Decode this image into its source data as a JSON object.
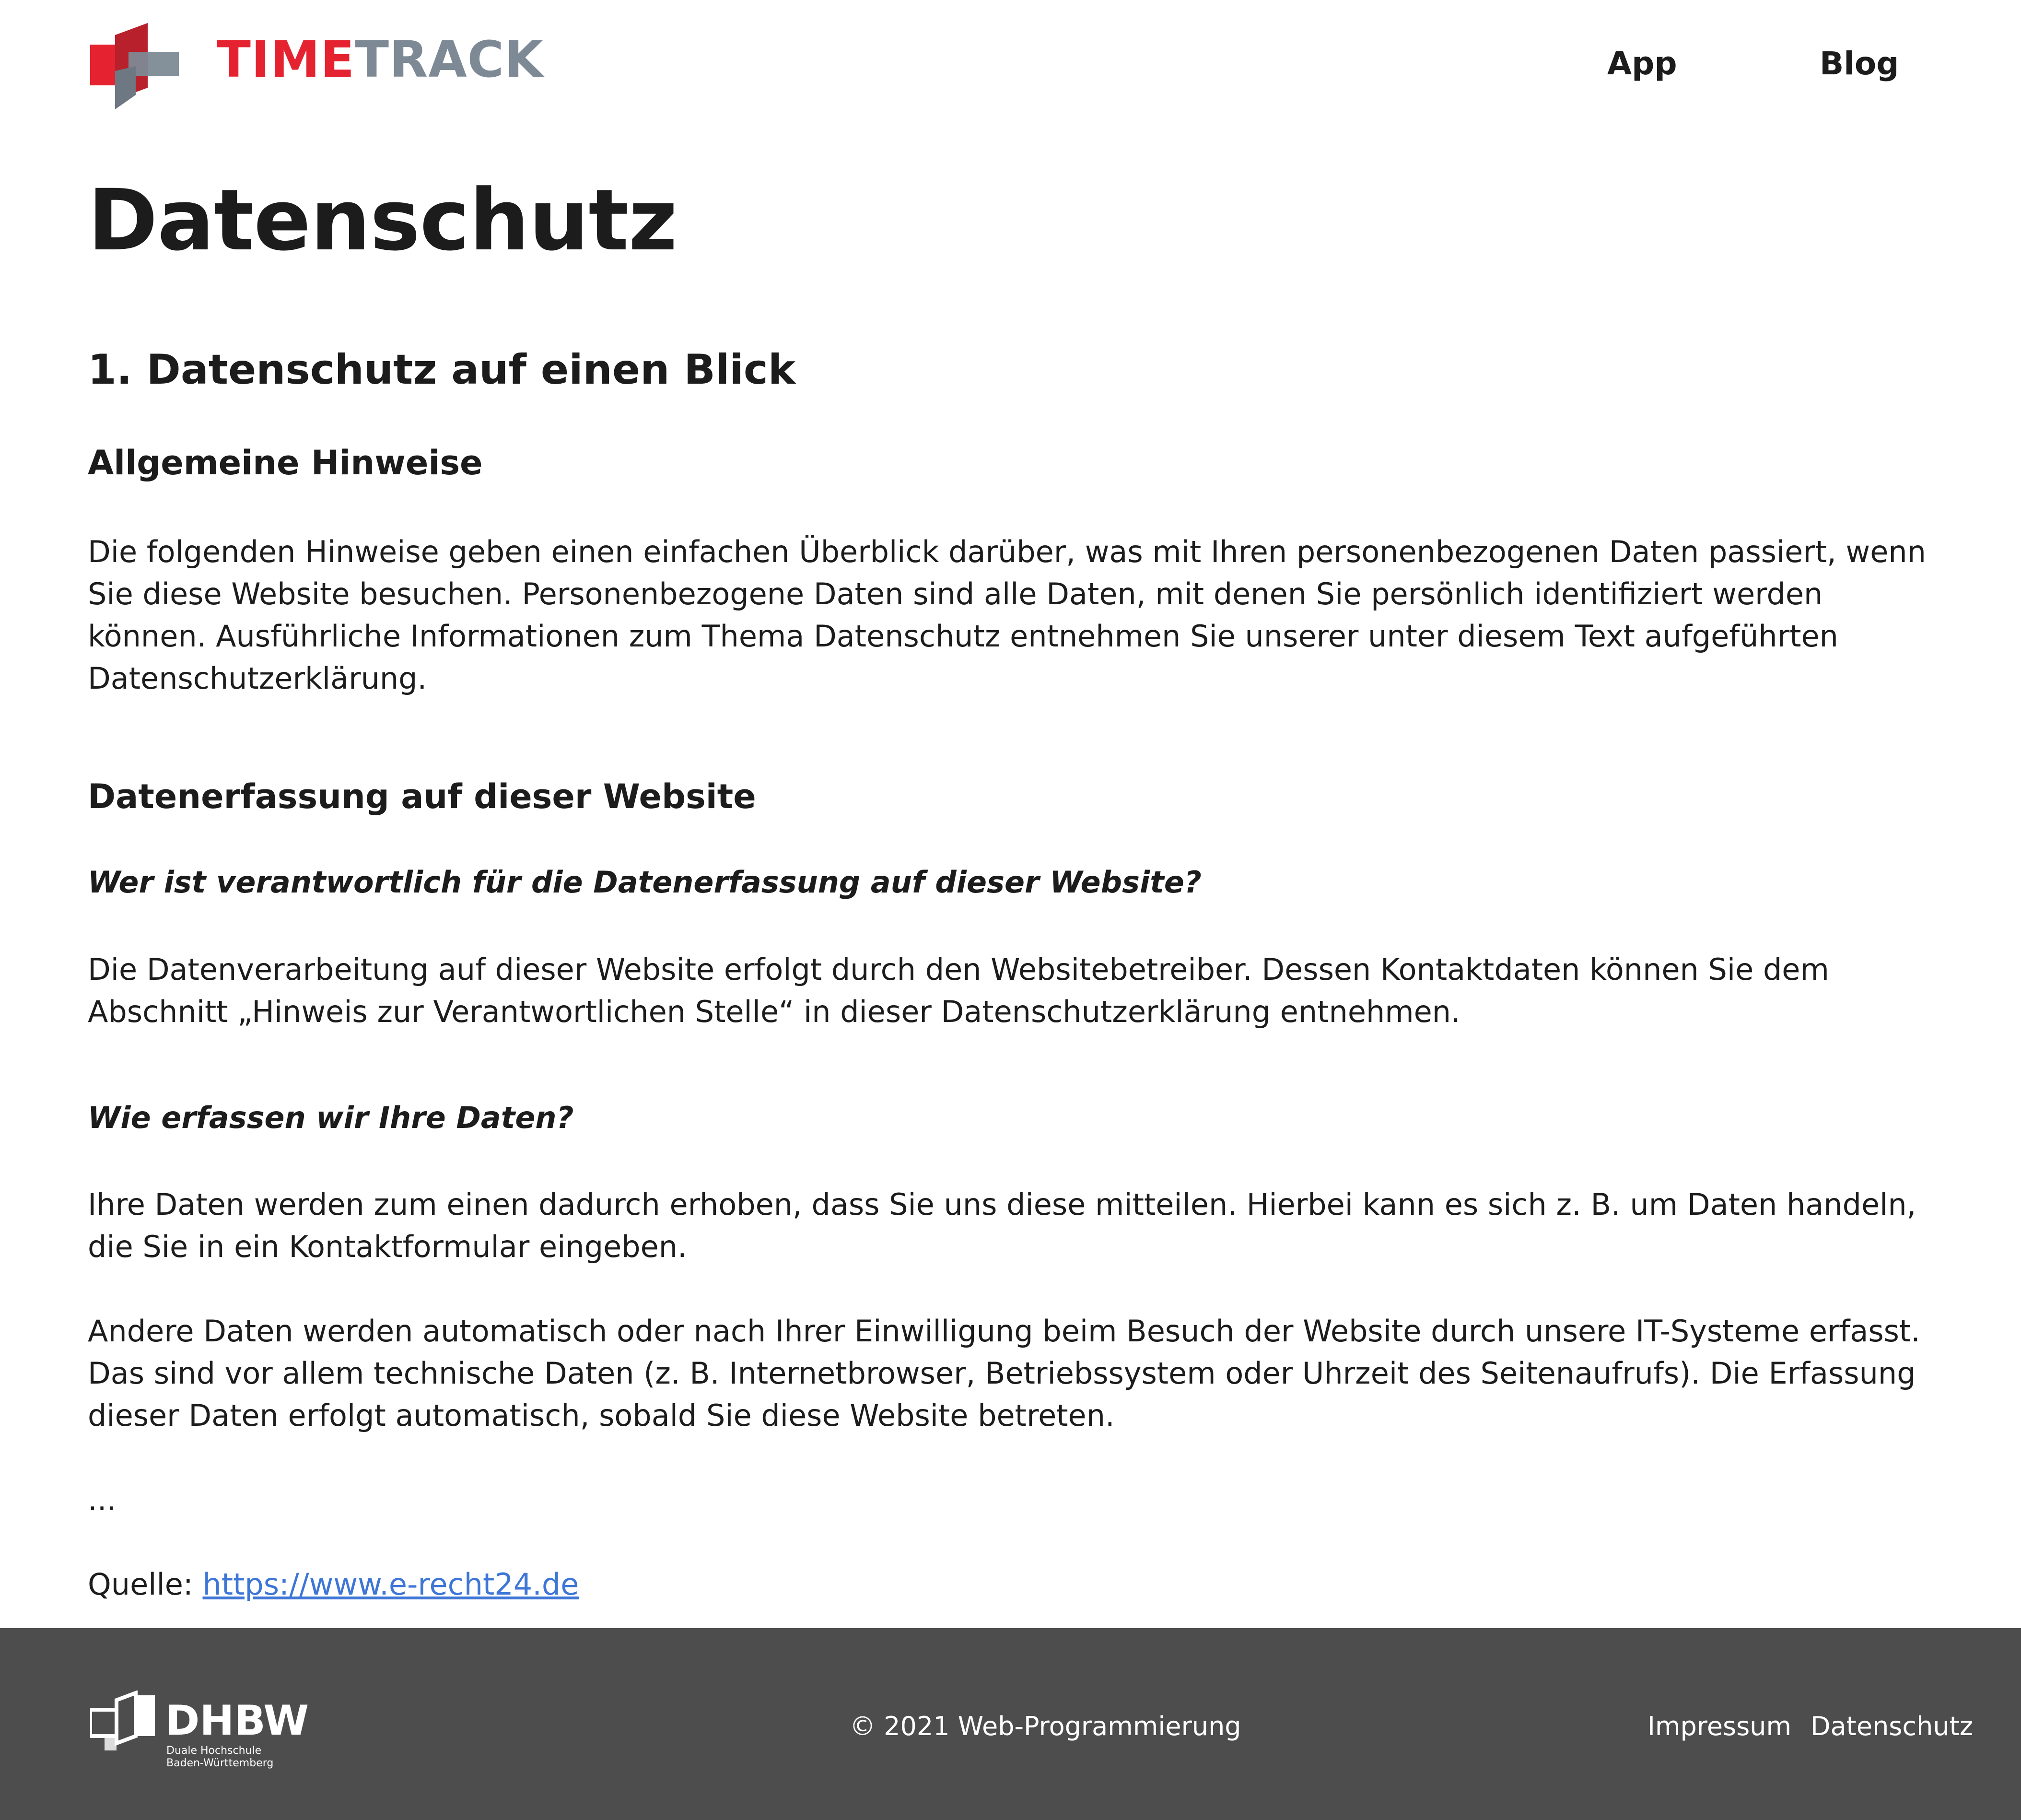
{
  "header": {
    "brand_part1": "TIME",
    "brand_part2": "TRACK",
    "logo_icon": "timetrack-logo-icon",
    "nav": [
      {
        "label": "App"
      },
      {
        "label": "Blog"
      }
    ],
    "colors": {
      "brand_red": "#e52330",
      "brand_gray": "#7d8a95"
    }
  },
  "main": {
    "title": "Datenschutz",
    "section1_heading": "1. Datenschutz auf einen Blick",
    "general_heading": "Allgemeine Hinweise",
    "general_text": "Die folgenden Hinweise geben einen einfachen Überblick darüber, was mit Ihren personenbezogenen Daten passiert, wenn Sie diese Website besuchen. Personenbezogene Daten sind alle Daten, mit denen Sie persönlich identifiziert werden können. Ausführliche Informationen zum Thema Datenschutz entnehmen Sie unserer unter diesem Text aufgeführten Datenschutzerklärung.",
    "collection_heading": "Datenerfassung auf dieser Website",
    "q1": "Wer ist verantwortlich für die Datenerfassung auf dieser Website?",
    "a1": "Die Datenverarbeitung auf dieser Website erfolgt durch den Websitebetreiber. Dessen Kontaktdaten können Sie dem Abschnitt „Hinweis zur Verantwortlichen Stelle“ in dieser Datenschutzerklärung entnehmen.",
    "q2": "Wie erfassen wir Ihre Daten?",
    "a2_1": "Ihre Daten werden zum einen dadurch erhoben, dass Sie uns diese mitteilen. Hierbei kann es sich z. B. um Daten handeln, die Sie in ein Kontaktformular eingeben.",
    "a2_2": "Andere Daten werden automatisch oder nach Ihrer Einwilligung beim Besuch der Website durch unsere IT-Systeme erfasst. Das sind vor allem technische Daten (z. B. Internetbrowser, Betriebssystem oder Uhrzeit des Seitenaufrufs). Die Erfassung dieser Daten erfolgt automatisch, sobald Sie diese Website betreten.",
    "ellipsis": "...",
    "source_label": "Quelle: ",
    "source_link": "https://www.e-recht24.de",
    "link_color": "#3d76d6"
  },
  "footer": {
    "logo_name": "DHBW",
    "logo_sub_1": "Duale Hochschule",
    "logo_sub_2": "Baden-Württemberg",
    "logo_icon": "dhbw-logo-icon",
    "copyright": "© 2021 Web-Programmierung",
    "links": [
      {
        "label": "Impressum"
      },
      {
        "label": "Datenschutz"
      }
    ],
    "background": "#4d4d4d"
  }
}
